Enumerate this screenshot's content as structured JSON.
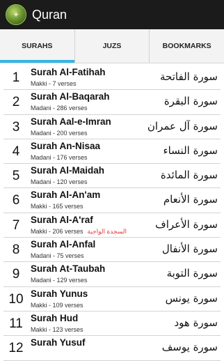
{
  "app": {
    "title": "Quran",
    "logo_icon": "quran-logo-icon"
  },
  "tabs": [
    {
      "label": "SURAHS",
      "active": true
    },
    {
      "label": "JUZS",
      "active": false
    },
    {
      "label": "BOOKMARKS",
      "active": false
    }
  ],
  "surahs": [
    {
      "number": "1",
      "name": "Surah Al-Fatihah",
      "meta": "Makki - 7 verses",
      "arabic": "سورة الفاتحة",
      "sajda": ""
    },
    {
      "number": "2",
      "name": "Surah Al-Baqarah",
      "meta": "Madani - 286 verses",
      "arabic": "سورة البقرة",
      "sajda": ""
    },
    {
      "number": "3",
      "name": "Surah Aal-e-Imran",
      "meta": "Madani - 200 verses",
      "arabic": "سورة آل عمران",
      "sajda": ""
    },
    {
      "number": "4",
      "name": "Surah An-Nisaa",
      "meta": "Madani - 176 verses",
      "arabic": "سورة النساء",
      "sajda": ""
    },
    {
      "number": "5",
      "name": "Surah Al-Maidah",
      "meta": "Madani - 120 verses",
      "arabic": "سورة المائدة",
      "sajda": ""
    },
    {
      "number": "6",
      "name": "Surah Al-An'am",
      "meta": "Makki - 165 verses",
      "arabic": "سورة الأنعام",
      "sajda": ""
    },
    {
      "number": "7",
      "name": "Surah Al-A'raf",
      "meta": "Makki - 206 verses",
      "arabic": "سورة الأعراف",
      "sajda": "السجدة الواجبة"
    },
    {
      "number": "8",
      "name": "Surah Al-Anfal",
      "meta": "Madani - 75 verses",
      "arabic": "سورة الأنفال",
      "sajda": ""
    },
    {
      "number": "9",
      "name": "Surah At-Taubah",
      "meta": "Madani - 129 verses",
      "arabic": "سورة التوبة",
      "sajda": ""
    },
    {
      "number": "10",
      "name": "Surah Yunus",
      "meta": "Makki - 109 verses",
      "arabic": "سورة يونس",
      "sajda": ""
    },
    {
      "number": "11",
      "name": "Surah Hud",
      "meta": "Makki - 123 verses",
      "arabic": "سورة هود",
      "sajda": ""
    },
    {
      "number": "12",
      "name": "Surah Yusuf",
      "meta": "",
      "arabic": "سورة يوسف",
      "sajda": ""
    }
  ]
}
